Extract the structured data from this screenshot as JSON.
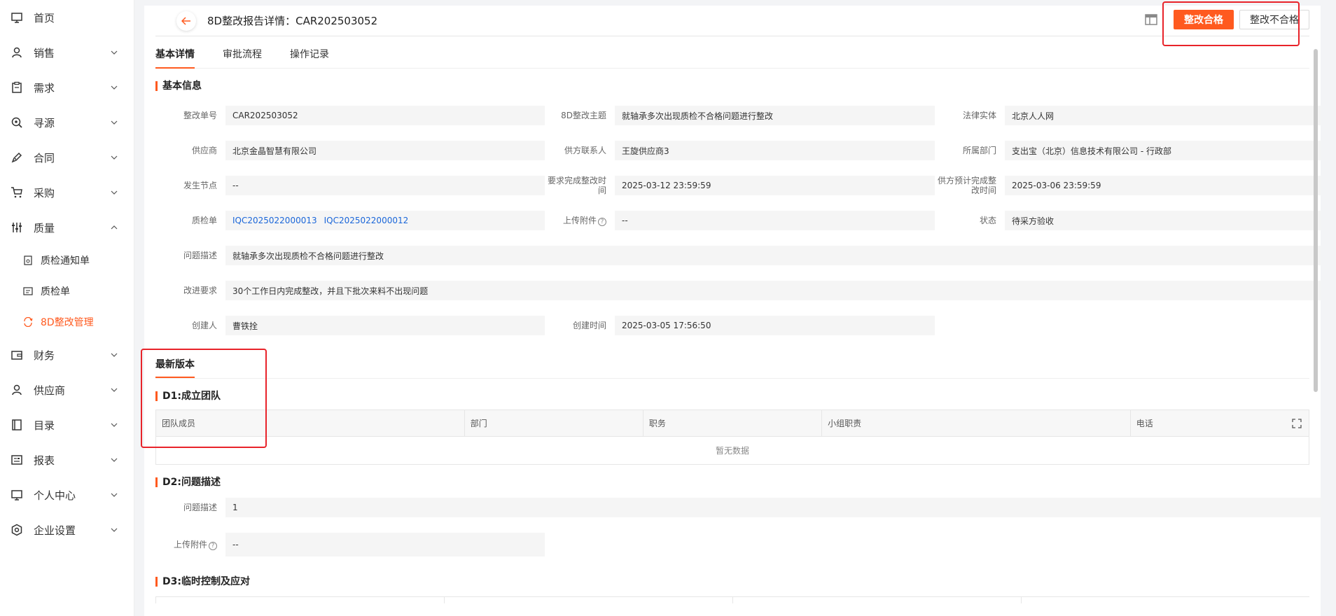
{
  "sidebar": {
    "items": [
      {
        "label": "首页",
        "icon": "monitor-icon",
        "has_chevron": false
      },
      {
        "label": "销售",
        "icon": "user-icon",
        "has_chevron": true
      },
      {
        "label": "需求",
        "icon": "clipboard-icon",
        "has_chevron": true
      },
      {
        "label": "寻源",
        "icon": "search-icon",
        "has_chevron": true
      },
      {
        "label": "合同",
        "icon": "pen-icon",
        "has_chevron": true
      },
      {
        "label": "采购",
        "icon": "cart-icon",
        "has_chevron": true
      },
      {
        "label": "质量",
        "icon": "sliders-icon",
        "has_chevron": true,
        "expanded": true
      }
    ],
    "sub_items": [
      {
        "label": "质检通知单",
        "icon": "doc-icon"
      },
      {
        "label": "质检单",
        "icon": "report-icon"
      },
      {
        "label": "8D整改管理",
        "icon": "refresh-icon",
        "active": true
      }
    ],
    "items_after": [
      {
        "label": "财务",
        "icon": "wallet-icon"
      },
      {
        "label": "供应商",
        "icon": "user-icon"
      },
      {
        "label": "目录",
        "icon": "book-icon"
      },
      {
        "label": "报表",
        "icon": "table-icon"
      },
      {
        "label": "个人中心",
        "icon": "monitor-icon"
      },
      {
        "label": "企业设置",
        "icon": "settings-icon"
      }
    ]
  },
  "header": {
    "title": "8D整改报告详情：CAR202503052",
    "pass_button": "整改合格",
    "fail_button": "整改不合格"
  },
  "tabs": [
    "基本详情",
    "审批流程",
    "操作记录"
  ],
  "basic": {
    "section_title": "基本信息",
    "fields": {
      "order_no_label": "整改单号",
      "order_no": "CAR202503052",
      "theme_label": "8D整改主题",
      "theme": "就轴承多次出现质检不合格问题进行整改",
      "entity_label": "法律实体",
      "entity": "北京人人网",
      "supplier_label": "供应商",
      "supplier": "北京金晶智慧有限公司",
      "contact_label": "供方联系人",
      "contact": "王旋供应商3",
      "dept_label": "所属部门",
      "dept": "支出宝（北京）信息技术有限公司 - 行政部",
      "node_label": "发生节点",
      "node": "--",
      "req_time_label": "要求完成整改时间",
      "req_time": "2025-03-12 23:59:59",
      "est_time_label": "供方预计完成整改时间",
      "est_time": "2025-03-06 23:59:59",
      "qc_label": "质检单",
      "qc_links": [
        "IQC2025022000013",
        "IQC2025022000012"
      ],
      "attach_label": "上传附件",
      "attach": "--",
      "status_label": "状态",
      "status": "待采方验收",
      "problem_label": "问题描述",
      "problem": "就轴承多次出现质检不合格问题进行整改",
      "improve_label": "改进要求",
      "improve": "30个工作日内完成整改，并且下批次来料不出现问题",
      "creator_label": "创建人",
      "creator": "曹铁拴",
      "created_label": "创建时间",
      "created": "2025-03-05 17:56:50"
    }
  },
  "version": {
    "title": "最新版本",
    "d1_title": "D1:成立团队",
    "team_columns": [
      "团队成员",
      "部门",
      "职务",
      "小组职责",
      "电话"
    ],
    "empty_text": "暂无数据",
    "d2_title": "D2:问题描述",
    "d2_problem_label": "问题描述",
    "d2_problem": "1",
    "d2_attach_label": "上传附件",
    "d2_attach": "--",
    "d3_title": "D3:临时控制及应对"
  }
}
